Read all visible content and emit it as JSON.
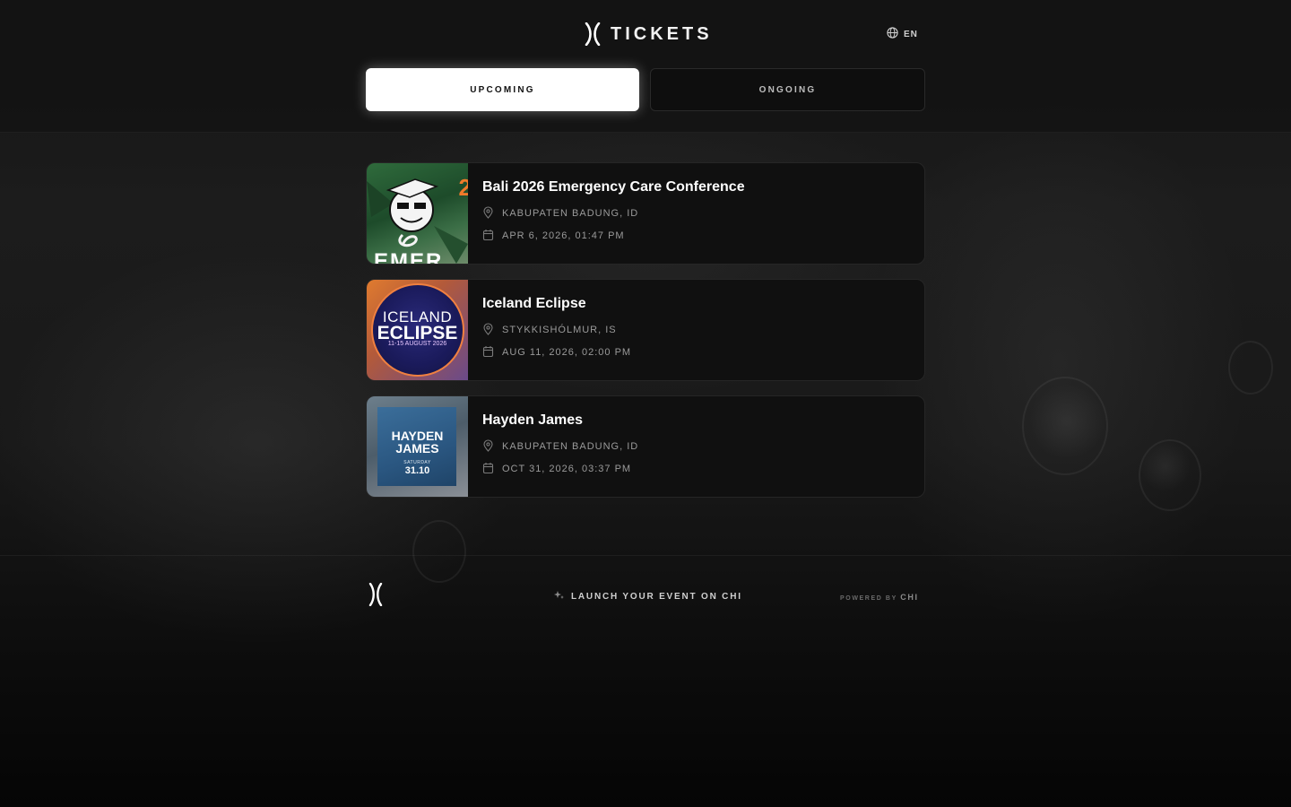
{
  "header": {
    "brand_title": "TICKETS",
    "language": "EN"
  },
  "tabs": [
    {
      "label": "UPCOMING",
      "active": true
    },
    {
      "label": "ONGOING",
      "active": false
    }
  ],
  "events": [
    {
      "name": "Bali 2026 Emergency Care Conference",
      "location": "KABUPATEN BADUNG, ID",
      "datetime": "APR 6, 2026, 01:47 PM",
      "thumb_text": "2",
      "thumb_text_bottom": "EMER"
    },
    {
      "name": "Iceland Eclipse",
      "location": "STYKKISHÓLMUR, IS",
      "datetime": "AUG 11, 2026, 02:00 PM",
      "thumb_title_1": "ICELAND",
      "thumb_title_2": "ECLIPSE",
      "thumb_sub": "11-15 AUGUST 2026"
    },
    {
      "name": "Hayden James",
      "location": "KABUPATEN BADUNG, ID",
      "datetime": "OCT 31, 2026, 03:37 PM",
      "thumb_title_1": "HAYDEN",
      "thumb_title_2": "JAMES",
      "thumb_day": "SATURDAY",
      "thumb_date": "31.10"
    }
  ],
  "footer": {
    "launch_label": "LAUNCH YOUR EVENT ON CHI",
    "powered_by": "POWERED BY",
    "powered_brand": "CHI"
  },
  "colors": {
    "background": "#0b0b0b",
    "tab_active_bg": "#ffffff",
    "card_bg": "#101010",
    "muted_text": "#9a9a9a",
    "accent_orange": "#f07a2a"
  }
}
